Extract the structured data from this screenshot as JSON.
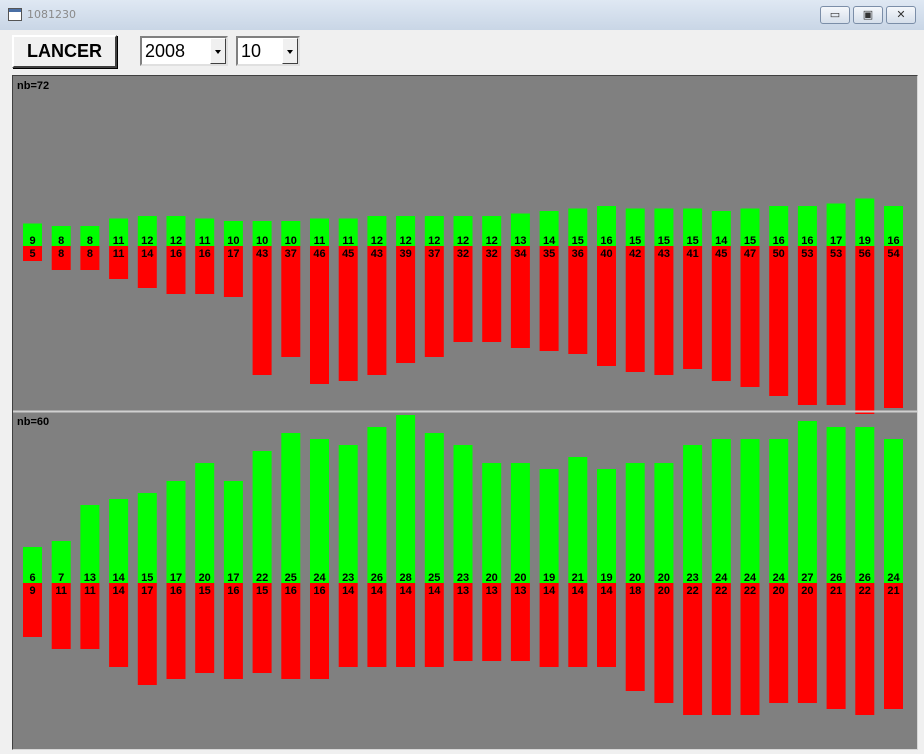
{
  "window": {
    "title": "1081230",
    "minimize_label": "▭",
    "maximize_label": "▣",
    "close_label": "✕"
  },
  "toolbar": {
    "launch_label": "LANCER",
    "year_value": "2008",
    "month_value": "10"
  },
  "colors": {
    "background": "#808080",
    "upper": "#00ff00",
    "lower": "#ff0000",
    "divider": "#d0d0d0"
  },
  "chart_data": [
    {
      "type": "bar",
      "title": "nb=72",
      "series": [
        {
          "values": [
            9,
            8,
            8,
            11,
            12,
            12,
            11,
            10,
            10,
            10,
            11,
            11,
            12,
            12,
            12,
            12,
            12,
            13,
            14,
            15,
            16,
            15,
            15,
            15,
            14,
            15,
            16,
            16,
            17,
            19,
            16
          ]
        },
        {
          "values": [
            5,
            8,
            8,
            11,
            14,
            16,
            16,
            17,
            43,
            37,
            46,
            45,
            43,
            39,
            37,
            32,
            32,
            34,
            35,
            36,
            40,
            42,
            43,
            41,
            45,
            47,
            50,
            53,
            53,
            56,
            54
          ]
        }
      ]
    },
    {
      "type": "bar",
      "title": "nb=60",
      "series": [
        {
          "values": [
            6,
            7,
            13,
            14,
            15,
            17,
            20,
            17,
            22,
            25,
            24,
            23,
            26,
            28,
            25,
            23,
            20,
            20,
            19,
            21,
            19,
            20,
            20,
            23,
            24,
            24,
            24,
            27,
            26,
            26,
            24
          ]
        },
        {
          "values": [
            9,
            11,
            11,
            14,
            17,
            16,
            15,
            16,
            15,
            16,
            16,
            14,
            14,
            14,
            14,
            13,
            13,
            13,
            14,
            14,
            14,
            18,
            20,
            22,
            22,
            22,
            20,
            20,
            21,
            22,
            21
          ]
        }
      ]
    }
  ]
}
